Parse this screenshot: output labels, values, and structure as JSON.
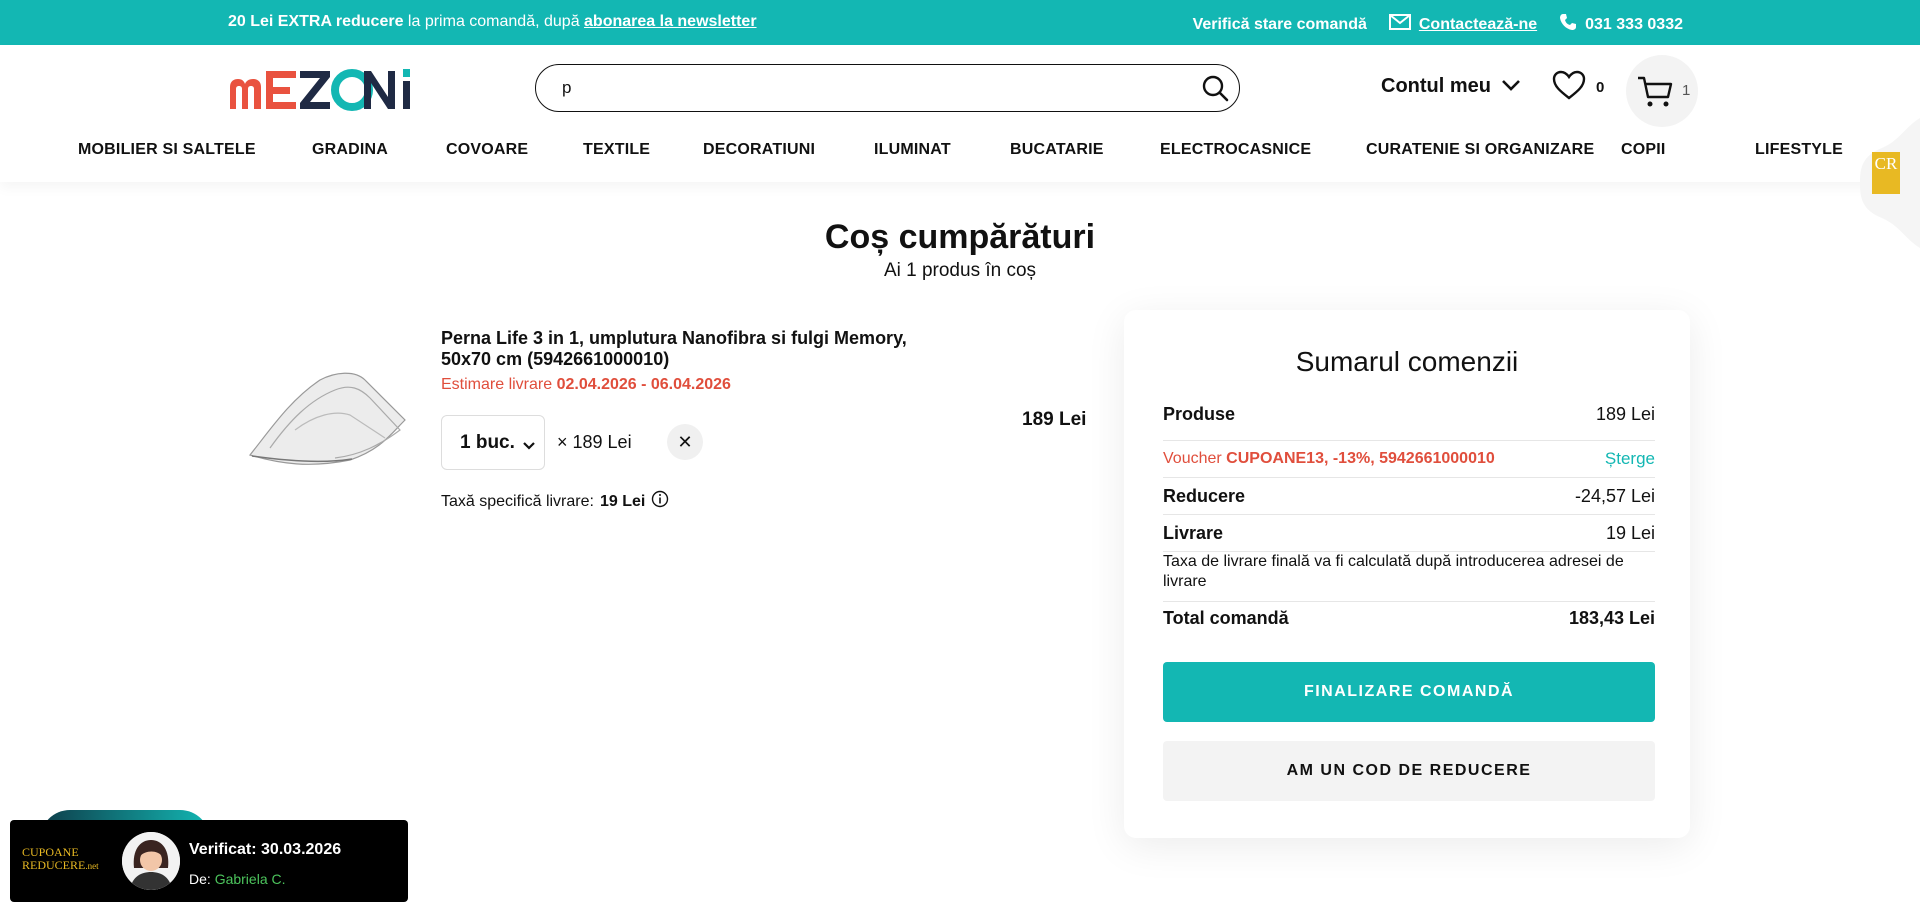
{
  "promo": {
    "amount": "20 Lei EXTRA reducere",
    "text_mid": " la prima comandă, după ",
    "newsletter_link": "abonarea la newsletter",
    "check_order": "Verifică stare comandă",
    "contact": "Contactează-ne",
    "phone": "031 333 0332"
  },
  "header": {
    "logo_text": "mEZONi",
    "search_value": "p",
    "account_label": "Contul meu",
    "wishlist_count": "0",
    "cart_count": "1"
  },
  "nav": {
    "items": [
      "MOBILIER SI SALTELE",
      "GRADINA",
      "COVOARE",
      "TEXTILE",
      "DECORATIUNI",
      "ILUMINAT",
      "BUCATARIE",
      "ELECTROCASNICE",
      "CURATENIE SI ORGANIZARE",
      "COPII",
      "LIFESTYLE"
    ]
  },
  "side_tab": {
    "badge": "CR"
  },
  "page": {
    "title": "Coș cumpărături",
    "subtitle": "Ai 1 produs în coș"
  },
  "product": {
    "name": "Perna Life 3 in 1, umplutura Nanofibra si fulgi Memory, 50x70 cm (5942661000010)",
    "delivery_label": "Estimare livrare ",
    "delivery_dates": "02.04.2026 - 06.04.2026",
    "quantity": "1 buc.",
    "unit_price": "× 189 Lei",
    "remove_symbol": "✕",
    "total_price": "189 Lei",
    "ship_fee_label": "Taxă specifică livrare: ",
    "ship_fee_value": "19 Lei"
  },
  "summary": {
    "title": "Sumarul comenzii",
    "products_label": "Produse",
    "products_value": "189 Lei",
    "voucher_label": "Voucher ",
    "voucher_code": "CUPOANE13, -13%, 5942661000010",
    "voucher_action": "Șterge",
    "discount_label": "Reducere",
    "discount_value": "-24,57 Lei",
    "delivery_label": "Livrare",
    "delivery_value": "19 Lei",
    "delivery_note": "Taxa de livrare finală va fi calculată după introducerea adresei de livrare",
    "total_label": "Total comandă",
    "total_value": "183,43 Lei",
    "checkout_button": "FINALIZARE COMANDĂ",
    "coupon_button": "AM UN COD DE REDUCERE"
  },
  "verified_widget": {
    "logo_line1": "CUPOANE",
    "logo_line2": "REDUCERE",
    "logo_suffix": ".net",
    "title": "Verificat: 30.03.2026",
    "by_label": "De: ",
    "by_name": "Gabriela C."
  },
  "colors": {
    "accent": "#13b7b3",
    "alert": "#e04e3c",
    "logo_red": "#e9523f",
    "logo_navy": "#1f2a44",
    "badge_gold": "#e8b923"
  }
}
